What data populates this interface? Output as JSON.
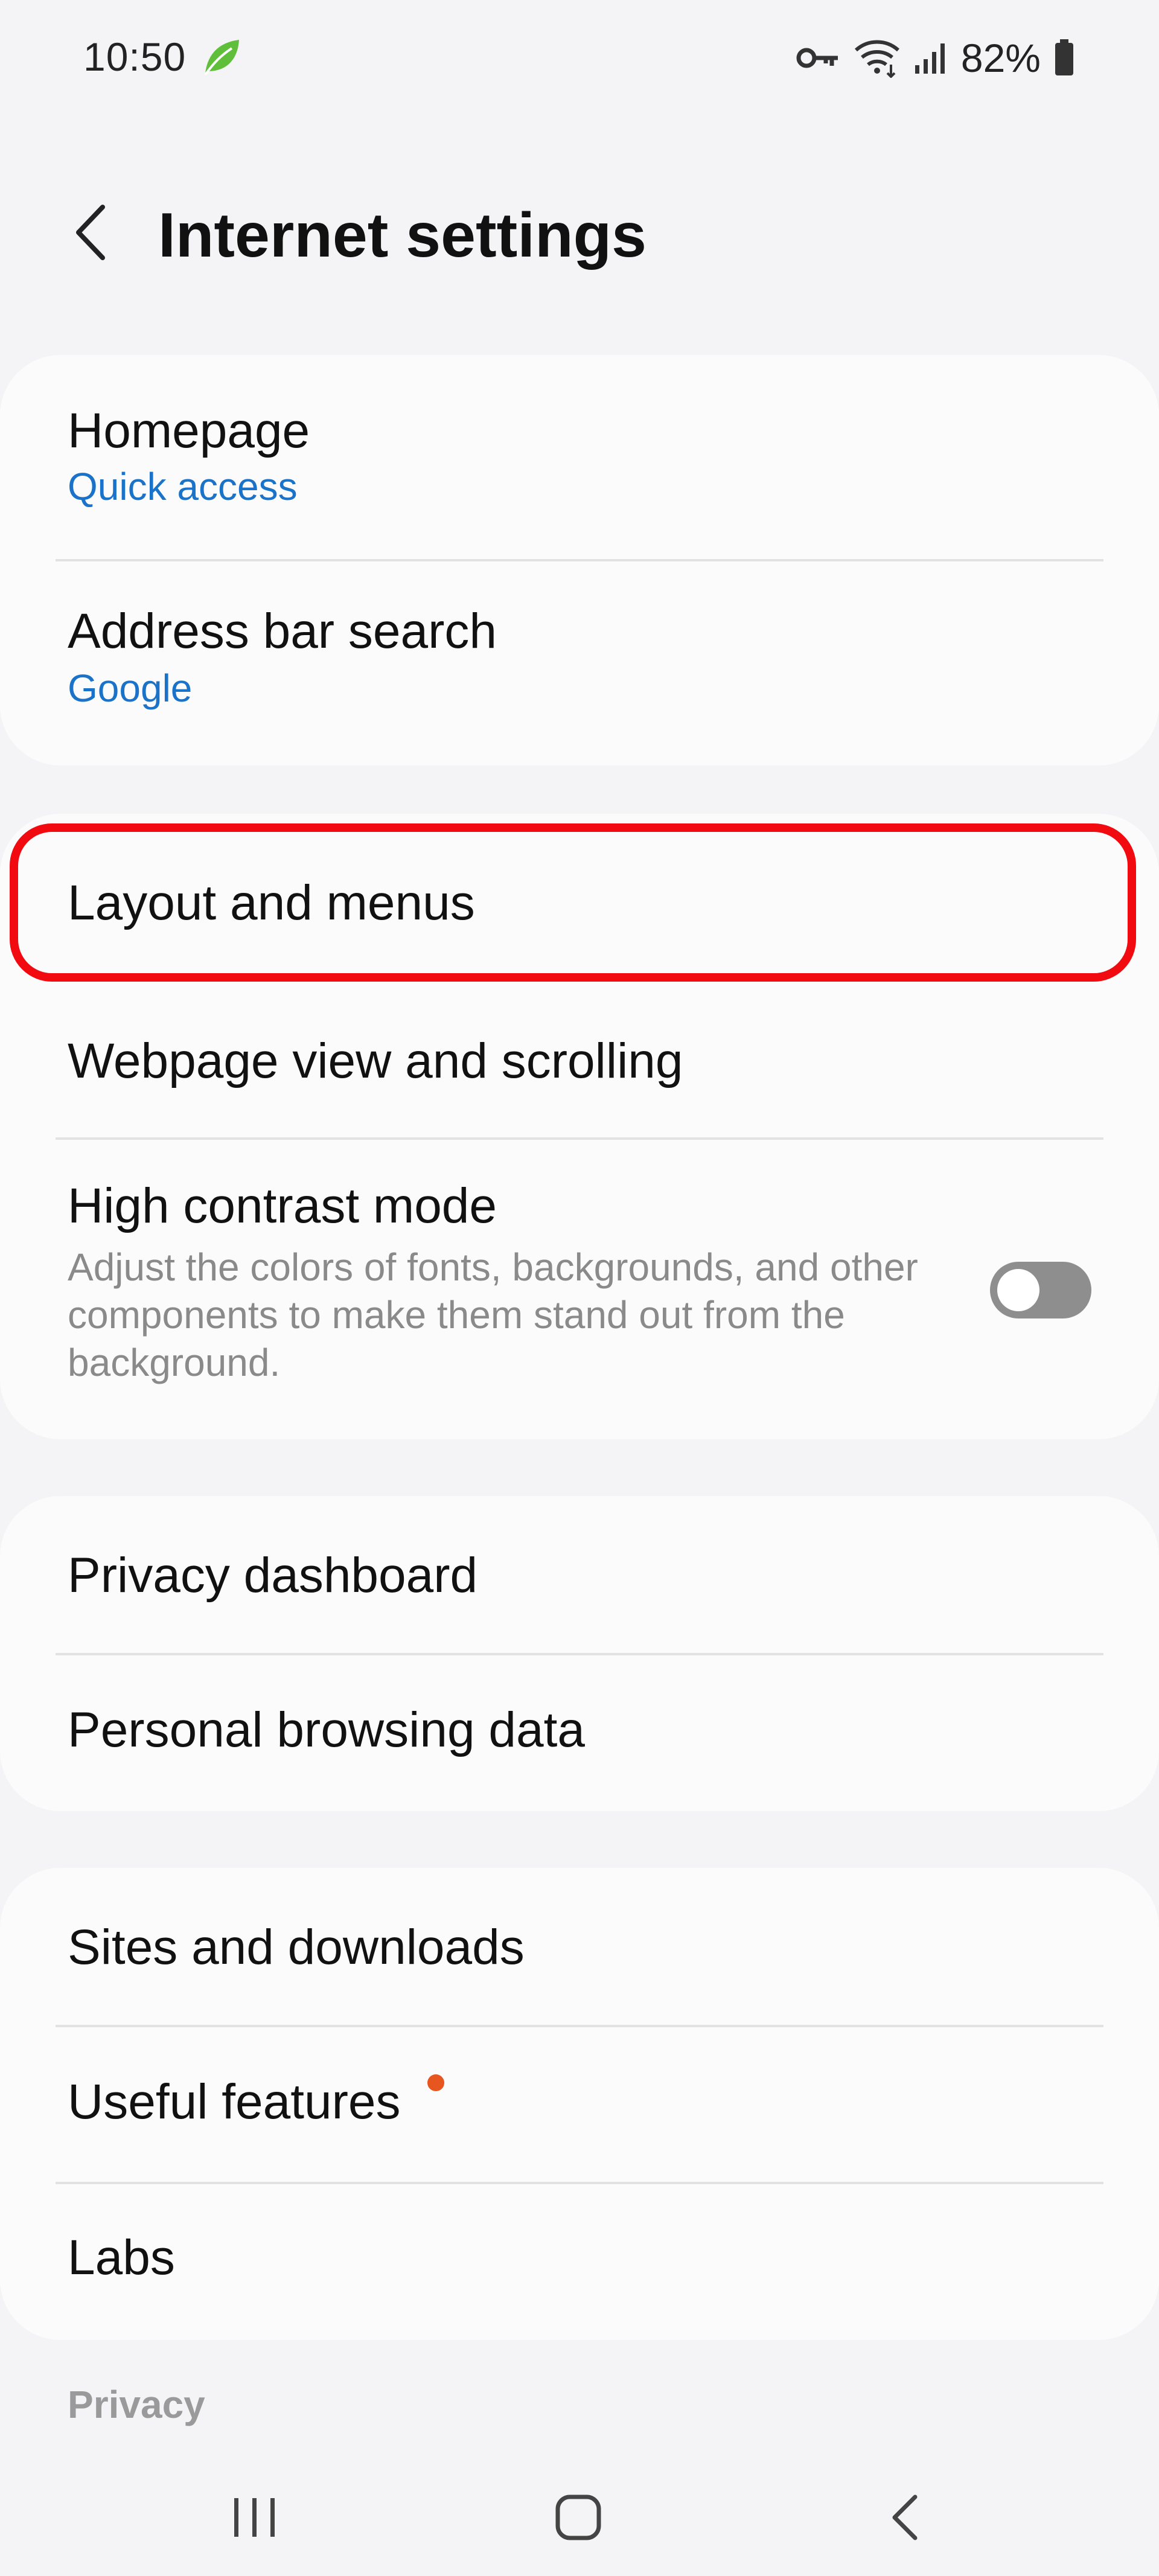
{
  "status_bar": {
    "time": "10:50",
    "battery": "82%",
    "icons": [
      "leaf-icon",
      "key-icon",
      "wifi-icon",
      "signal-icon",
      "battery-icon"
    ]
  },
  "header": {
    "title": "Internet settings",
    "back_icon": "chevron-left-icon"
  },
  "group1": {
    "homepage": {
      "title": "Homepage",
      "value": "Quick access"
    },
    "address_bar": {
      "title": "Address bar search",
      "value": "Google"
    }
  },
  "group2": {
    "layout": {
      "title": "Layout and menus"
    },
    "webpage_view": {
      "title": "Webpage view and scrolling"
    },
    "high_contrast": {
      "title": "High contrast mode",
      "description": "Adjust the colors of fonts, backgrounds, and other components to make them stand out from the background.",
      "enabled": false
    }
  },
  "group3": {
    "privacy_dashboard": {
      "title": "Privacy dashboard"
    },
    "personal_data": {
      "title": "Personal browsing data"
    }
  },
  "group4": {
    "sites_downloads": {
      "title": "Sites and downloads"
    },
    "useful_features": {
      "title": "Useful features",
      "has_new_badge": true
    },
    "labs": {
      "title": "Labs"
    }
  },
  "section_label": "Privacy",
  "colors": {
    "link_blue": "#1a73c9",
    "highlight_red": "#f10a10",
    "badge_orange": "#e8561f",
    "toggle_off": "#8e8e8e"
  },
  "nav_bar": {
    "icons": [
      "recent-apps-icon",
      "home-icon",
      "back-icon"
    ]
  }
}
